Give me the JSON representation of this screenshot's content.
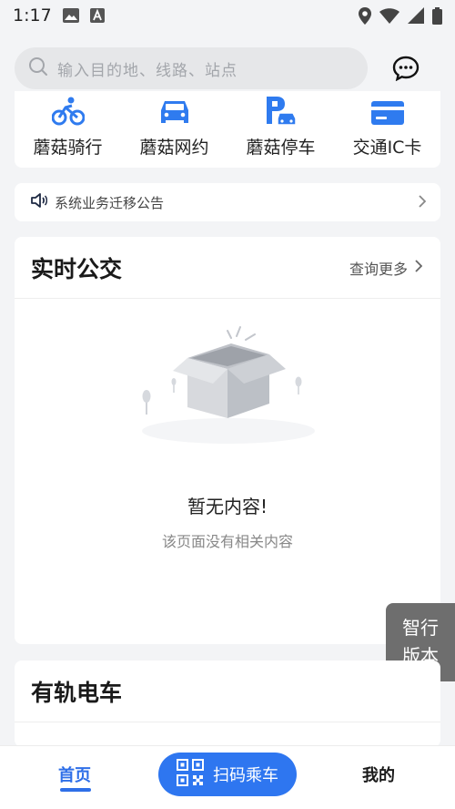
{
  "status_bar": {
    "time": "1:17",
    "left_icons": [
      "image-icon",
      "a-letter-icon"
    ],
    "right_icons": [
      "location-pin-icon",
      "wifi-icon",
      "cellular-signal-icon",
      "battery-icon"
    ]
  },
  "search": {
    "placeholder": "输入目的地、线路、站点",
    "message_icon": "message-bubble-icon"
  },
  "services": [
    {
      "label": "蘑菇骑行",
      "icon": "bicycle-icon"
    },
    {
      "label": "蘑菇网约",
      "icon": "car-icon"
    },
    {
      "label": "蘑菇停车",
      "icon": "parking-icon"
    },
    {
      "label": "交通IC卡",
      "icon": "ic-card-icon"
    }
  ],
  "notice": {
    "text": "系统业务迁移公告",
    "icon": "speaker-icon"
  },
  "realtime_bus": {
    "title": "实时公交",
    "more_label": "查询更多",
    "empty_title": "暂无内容!",
    "empty_subtitle": "该页面没有相关内容"
  },
  "smart_version": {
    "line1": "智行",
    "line2": "版本"
  },
  "tram": {
    "title": "有轨电车"
  },
  "bottom_nav": {
    "home": "首页",
    "scan": "扫码乘车",
    "mine": "我的"
  },
  "colors": {
    "accent": "#2e76f0",
    "background": "#f3f4f6",
    "icon_blue": "#2f7bef"
  }
}
